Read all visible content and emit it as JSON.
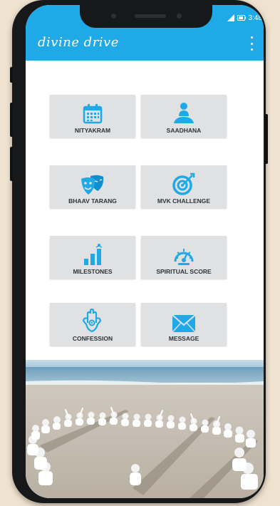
{
  "status": {
    "time": "3:48"
  },
  "app": {
    "title": "divine drive"
  },
  "tiles": [
    {
      "label": "NITYAKRAM"
    },
    {
      "label": "SAADHANA"
    },
    {
      "label": "BHAAV TARANG"
    },
    {
      "label": "MVK CHALLENGE"
    },
    {
      "label": "MILESTONES"
    },
    {
      "label": "SPIRITUAL SCORE"
    },
    {
      "label": "CONFESSION"
    },
    {
      "label": "MESSAGE"
    }
  ],
  "colors": {
    "accent": "#1fa9e6",
    "tile_bg": "#dfe1e3",
    "icon": "#1fa9e6"
  }
}
